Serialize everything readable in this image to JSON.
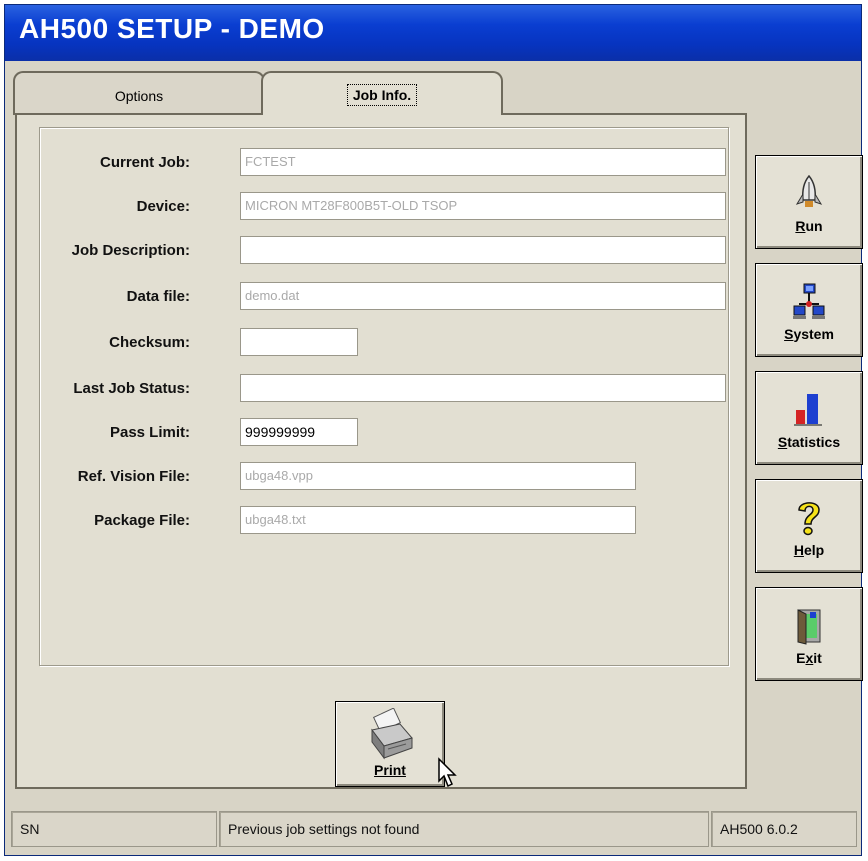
{
  "window": {
    "title": "AH500  SETUP  - DEMO"
  },
  "tabs": [
    {
      "label": "Options",
      "active": false
    },
    {
      "label": "Job Info.",
      "active": true
    }
  ],
  "fields": [
    {
      "label": "Current Job:",
      "value": "FCTEST",
      "enabled": false
    },
    {
      "label": "Device:",
      "value": "MICRON MT28F800B5T-OLD TSOP",
      "enabled": false
    },
    {
      "label": "Job Description:",
      "value": "",
      "enabled": true
    },
    {
      "label": "Data file:",
      "value": "demo.dat",
      "enabled": false
    },
    {
      "label": "Checksum:",
      "value": "",
      "enabled": true
    },
    {
      "label": "Last Job Status:",
      "value": "",
      "enabled": true
    },
    {
      "label": "Pass Limit:",
      "value": "999999999",
      "enabled": true
    },
    {
      "label": "Ref. Vision File:",
      "value": "ubga48.vpp",
      "enabled": false
    },
    {
      "label": "Package File:",
      "value": "ubga48.txt",
      "enabled": false
    }
  ],
  "print_button": {
    "label": "Print",
    "icon": "printer-icon"
  },
  "side_buttons": [
    {
      "label_pre": "",
      "label_u": "R",
      "label_post": "un",
      "icon": "rocket-icon"
    },
    {
      "label_pre": "",
      "label_u": "S",
      "label_post": "ystem",
      "icon": "network-icon"
    },
    {
      "label_pre": "",
      "label_u": "S",
      "label_post": "tatistics",
      "icon": "bar-chart-icon"
    },
    {
      "label_pre": "",
      "label_u": "H",
      "label_post": "elp",
      "icon": "question-icon"
    },
    {
      "label_pre": "E",
      "label_u": "x",
      "label_post": "it",
      "icon": "door-exit-icon"
    }
  ],
  "status_bar": {
    "left": "SN",
    "message": "Previous job settings not found",
    "version": "AH500 6.0.2"
  },
  "colors": {
    "title_bar": "#0a3ed1",
    "window_bg": "#d8d4c6",
    "disabled_text": "#a9a9a9"
  }
}
